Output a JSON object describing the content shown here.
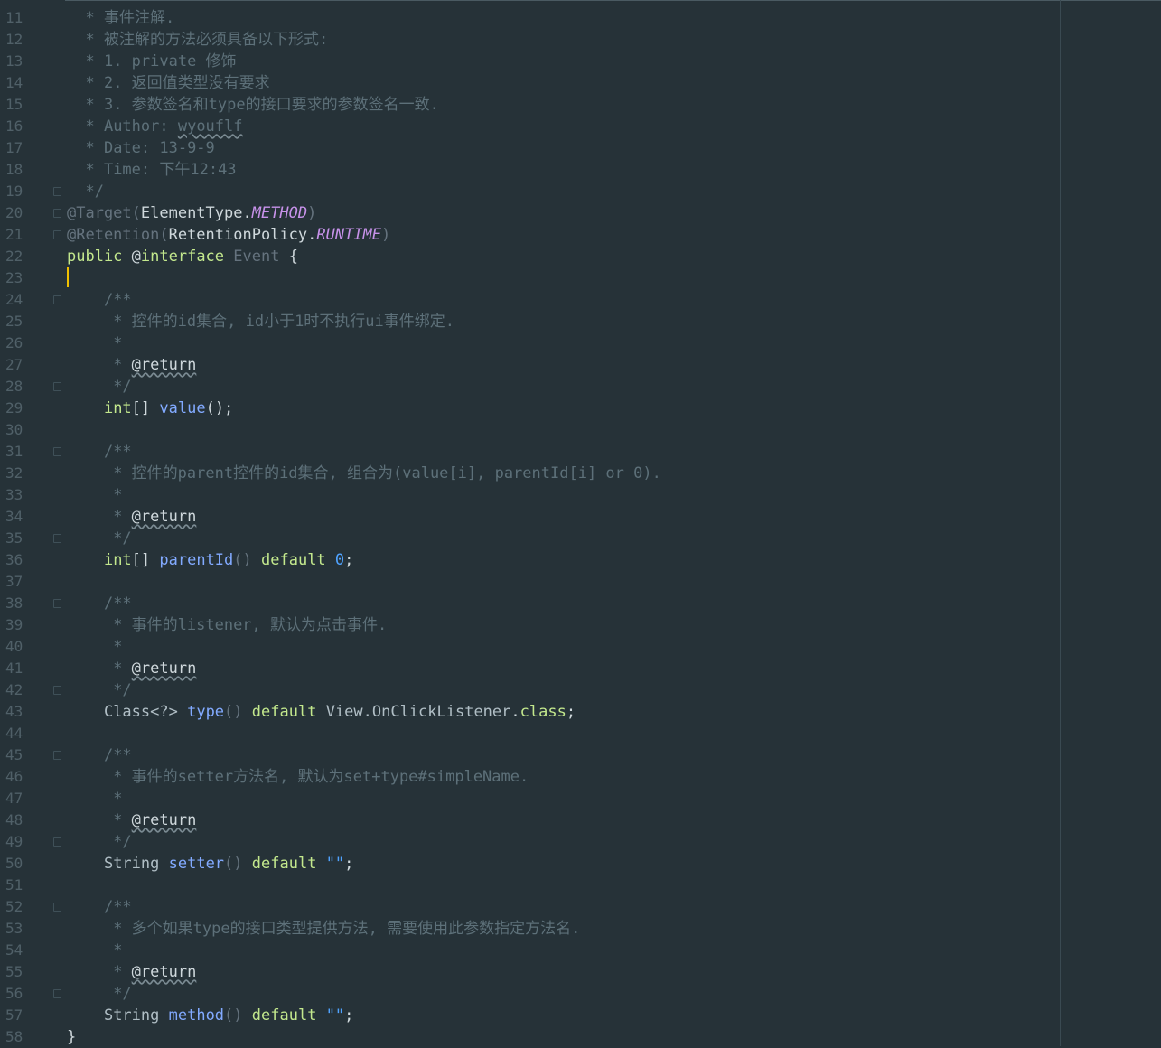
{
  "editor": {
    "theme_colors": {
      "background": "#263238",
      "keyword": "#c3e88d",
      "comment": "#5d7079",
      "constant": "#c792ea",
      "number": "#4fa3ff",
      "cursor": "#f0c000"
    },
    "lines": [
      {
        "n": "11",
        "indent": "  ",
        "tokens": [
          [
            "comment",
            "* 事件注解."
          ]
        ]
      },
      {
        "n": "12",
        "indent": "  ",
        "tokens": [
          [
            "comment",
            "* 被注解的方法必须具备以下形式:"
          ]
        ]
      },
      {
        "n": "13",
        "indent": "  ",
        "tokens": [
          [
            "comment",
            "* 1. private 修饰"
          ]
        ]
      },
      {
        "n": "14",
        "indent": "  ",
        "tokens": [
          [
            "comment",
            "* 2. 返回值类型没有要求"
          ]
        ]
      },
      {
        "n": "15",
        "indent": "  ",
        "tokens": [
          [
            "comment",
            "* 3. 参数签名和type的接口要求的参数签名一致."
          ]
        ]
      },
      {
        "n": "16",
        "indent": "  ",
        "tokens": [
          [
            "comment",
            "* Author: "
          ],
          [
            "wavy",
            "wyouflf"
          ]
        ]
      },
      {
        "n": "17",
        "indent": "  ",
        "tokens": [
          [
            "comment",
            "* Date: 13-9-9"
          ]
        ]
      },
      {
        "n": "18",
        "indent": "  ",
        "tokens": [
          [
            "comment",
            "* Time: 下午12:43"
          ]
        ]
      },
      {
        "n": "19",
        "indent": "  ",
        "fold": true,
        "tokens": [
          [
            "comment",
            "*/"
          ]
        ]
      },
      {
        "n": "20",
        "indent": "",
        "fold": true,
        "tokens": [
          [
            "ann",
            "@Target("
          ],
          [
            "plain",
            "ElementType."
          ],
          [
            "field",
            "METHOD"
          ],
          [
            "ann",
            ")"
          ]
        ]
      },
      {
        "n": "21",
        "indent": "",
        "fold": true,
        "tokens": [
          [
            "ann",
            "@Retention("
          ],
          [
            "plain",
            "RetentionPolicy."
          ],
          [
            "field",
            "RUNTIME"
          ],
          [
            "ann",
            ")"
          ]
        ]
      },
      {
        "n": "22",
        "indent": "",
        "tokens": [
          [
            "kw",
            "public"
          ],
          [
            "plain",
            " @"
          ],
          [
            "kw",
            "interface"
          ],
          [
            "plain",
            " "
          ],
          [
            "grey",
            "Event"
          ],
          [
            "plain",
            " {"
          ]
        ]
      },
      {
        "n": "23",
        "indent": "",
        "tokens": []
      },
      {
        "n": "24",
        "indent": "    ",
        "fold": true,
        "tokens": [
          [
            "comment",
            "/**"
          ]
        ]
      },
      {
        "n": "25",
        "indent": "     ",
        "tokens": [
          [
            "comment",
            "* 控件的id集合, id小于1时不执行ui事件绑定."
          ]
        ]
      },
      {
        "n": "26",
        "indent": "     ",
        "tokens": [
          [
            "comment",
            "*"
          ]
        ]
      },
      {
        "n": "27",
        "indent": "     ",
        "tokens": [
          [
            "comment",
            "* "
          ],
          [
            "wavyplain",
            "@return"
          ]
        ]
      },
      {
        "n": "28",
        "indent": "     ",
        "fold": true,
        "tokens": [
          [
            "comment",
            "*/"
          ]
        ]
      },
      {
        "n": "29",
        "indent": "    ",
        "tokens": [
          [
            "kw",
            "int"
          ],
          [
            "plain",
            "[] "
          ],
          [
            "method",
            "value"
          ],
          [
            "plain",
            "();"
          ]
        ]
      },
      {
        "n": "30",
        "indent": "",
        "tokens": []
      },
      {
        "n": "31",
        "indent": "    ",
        "fold": true,
        "tokens": [
          [
            "comment",
            "/**"
          ]
        ]
      },
      {
        "n": "32",
        "indent": "     ",
        "tokens": [
          [
            "comment",
            "* 控件的parent控件的id集合, 组合为(value[i], parentId[i] or 0)."
          ]
        ]
      },
      {
        "n": "33",
        "indent": "     ",
        "tokens": [
          [
            "comment",
            "*"
          ]
        ]
      },
      {
        "n": "34",
        "indent": "     ",
        "tokens": [
          [
            "comment",
            "* "
          ],
          [
            "wavyplain",
            "@return"
          ]
        ]
      },
      {
        "n": "35",
        "indent": "     ",
        "fold": true,
        "tokens": [
          [
            "comment",
            "*/"
          ]
        ]
      },
      {
        "n": "36",
        "indent": "    ",
        "tokens": [
          [
            "kw",
            "int"
          ],
          [
            "plain",
            "[] "
          ],
          [
            "method",
            "parentId"
          ],
          [
            "grey",
            "()"
          ],
          [
            "plain",
            " "
          ],
          [
            "kw",
            "default"
          ],
          [
            "plain",
            " "
          ],
          [
            "num",
            "0"
          ],
          [
            "plain",
            ";"
          ]
        ]
      },
      {
        "n": "37",
        "indent": "",
        "tokens": []
      },
      {
        "n": "38",
        "indent": "    ",
        "fold": true,
        "tokens": [
          [
            "comment",
            "/**"
          ]
        ]
      },
      {
        "n": "39",
        "indent": "     ",
        "tokens": [
          [
            "comment",
            "* 事件的listener, 默认为点击事件."
          ]
        ]
      },
      {
        "n": "40",
        "indent": "     ",
        "tokens": [
          [
            "comment",
            "*"
          ]
        ]
      },
      {
        "n": "41",
        "indent": "     ",
        "tokens": [
          [
            "comment",
            "* "
          ],
          [
            "wavyplain",
            "@return"
          ]
        ]
      },
      {
        "n": "42",
        "indent": "     ",
        "fold": true,
        "tokens": [
          [
            "comment",
            "*/"
          ]
        ]
      },
      {
        "n": "43",
        "indent": "    ",
        "tokens": [
          [
            "type",
            "Class<?>"
          ],
          [
            "plain",
            " "
          ],
          [
            "method",
            "type"
          ],
          [
            "grey",
            "()"
          ],
          [
            "plain",
            " "
          ],
          [
            "kw",
            "default"
          ],
          [
            "plain",
            " "
          ],
          [
            "type",
            "View.OnClickListener"
          ],
          [
            "plain",
            "."
          ],
          [
            "kw",
            "class"
          ],
          [
            "plain",
            ";"
          ]
        ]
      },
      {
        "n": "44",
        "indent": "",
        "tokens": []
      },
      {
        "n": "45",
        "indent": "    ",
        "fold": true,
        "tokens": [
          [
            "comment",
            "/**"
          ]
        ]
      },
      {
        "n": "46",
        "indent": "     ",
        "tokens": [
          [
            "comment",
            "* 事件的setter方法名, 默认为set+type#simpleName."
          ]
        ]
      },
      {
        "n": "47",
        "indent": "     ",
        "tokens": [
          [
            "comment",
            "*"
          ]
        ]
      },
      {
        "n": "48",
        "indent": "     ",
        "tokens": [
          [
            "comment",
            "* "
          ],
          [
            "wavyplain",
            "@return"
          ]
        ]
      },
      {
        "n": "49",
        "indent": "     ",
        "fold": true,
        "tokens": [
          [
            "comment",
            "*/"
          ]
        ]
      },
      {
        "n": "50",
        "indent": "    ",
        "tokens": [
          [
            "type",
            "String"
          ],
          [
            "plain",
            " "
          ],
          [
            "method",
            "setter"
          ],
          [
            "grey",
            "()"
          ],
          [
            "plain",
            " "
          ],
          [
            "kw",
            "default"
          ],
          [
            "plain",
            " "
          ],
          [
            "num",
            "\"\""
          ],
          [
            "plain",
            ";"
          ]
        ]
      },
      {
        "n": "51",
        "indent": "",
        "tokens": []
      },
      {
        "n": "52",
        "indent": "    ",
        "fold": true,
        "tokens": [
          [
            "comment",
            "/**"
          ]
        ]
      },
      {
        "n": "53",
        "indent": "     ",
        "tokens": [
          [
            "comment",
            "* 多个如果type的接口类型提供方法, 需要使用此参数指定方法名."
          ]
        ]
      },
      {
        "n": "54",
        "indent": "     ",
        "tokens": [
          [
            "comment",
            "*"
          ]
        ]
      },
      {
        "n": "55",
        "indent": "     ",
        "tokens": [
          [
            "comment",
            "* "
          ],
          [
            "wavyplain",
            "@return"
          ]
        ]
      },
      {
        "n": "56",
        "indent": "     ",
        "fold": true,
        "tokens": [
          [
            "comment",
            "*/"
          ]
        ]
      },
      {
        "n": "57",
        "indent": "    ",
        "tokens": [
          [
            "type",
            "String"
          ],
          [
            "plain",
            " "
          ],
          [
            "method",
            "method"
          ],
          [
            "grey",
            "()"
          ],
          [
            "plain",
            " "
          ],
          [
            "kw",
            "default"
          ],
          [
            "plain",
            " "
          ],
          [
            "num",
            "\"\""
          ],
          [
            "plain",
            ";"
          ]
        ]
      },
      {
        "n": "58",
        "indent": "",
        "tokens": [
          [
            "plain",
            "}"
          ]
        ]
      }
    ]
  }
}
